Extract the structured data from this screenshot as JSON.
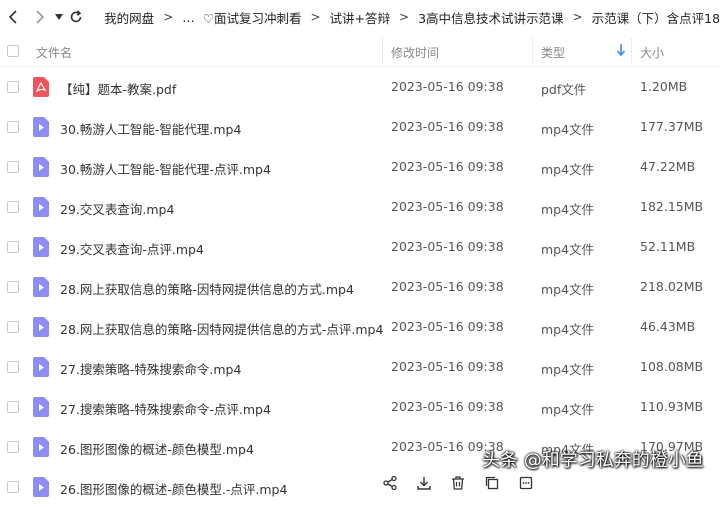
{
  "breadcrumb": [
    "我的网盘",
    "…",
    "♡面试复习冲刺看",
    "试讲+答辩",
    "3高中信息技术试讲示范课",
    "示范课（下）含点评18"
  ],
  "columns": {
    "name": "文件名",
    "time": "修改时间",
    "type": "类型",
    "size": "大小"
  },
  "sort_icon": "sort-down-arrow-icon",
  "colors": {
    "pdf": "#f0545c",
    "video": "#8c8cf2",
    "accent": "#3c8cf0"
  },
  "files": [
    {
      "name": "【纯】题本-教案.pdf",
      "time": "2023-05-16 09:38",
      "type": "pdf文件",
      "size": "1.20MB",
      "icon": "pdf-file-icon"
    },
    {
      "name": "30.畅游人工智能-智能代理.mp4",
      "time": "2023-05-16 09:38",
      "type": "mp4文件",
      "size": "177.37MB",
      "icon": "video-file-icon"
    },
    {
      "name": "30.畅游人工智能-智能代理-点评.mp4",
      "time": "2023-05-16 09:38",
      "type": "mp4文件",
      "size": "47.22MB",
      "icon": "video-file-icon"
    },
    {
      "name": "29.交叉表查询.mp4",
      "time": "2023-05-16 09:38",
      "type": "mp4文件",
      "size": "182.15MB",
      "icon": "video-file-icon"
    },
    {
      "name": "29.交叉表查询-点评.mp4",
      "time": "2023-05-16 09:38",
      "type": "mp4文件",
      "size": "52.11MB",
      "icon": "video-file-icon"
    },
    {
      "name": "28.网上获取信息的策略-因特网提供信息的方式.mp4",
      "time": "2023-05-16 09:38",
      "type": "mp4文件",
      "size": "218.02MB",
      "icon": "video-file-icon"
    },
    {
      "name": "28.网上获取信息的策略-因特网提供信息的方式-点评.mp4",
      "time": "2023-05-16 09:38",
      "type": "mp4文件",
      "size": "46.43MB",
      "icon": "video-file-icon"
    },
    {
      "name": "27.搜索策略-特殊搜索命令.mp4",
      "time": "2023-05-16 09:38",
      "type": "mp4文件",
      "size": "108.08MB",
      "icon": "video-file-icon"
    },
    {
      "name": "27.搜索策略-特殊搜索命令-点评.mp4",
      "time": "2023-05-16 09:38",
      "type": "mp4文件",
      "size": "110.93MB",
      "icon": "video-file-icon"
    },
    {
      "name": "26.图形图像的概述-颜色模型.mp4",
      "time": "2023-05-16 09:38",
      "type": "mp4文件",
      "size": "170.97MB",
      "icon": "video-file-icon"
    },
    {
      "name": "26.图形图像的概述-颜色模型.-点评.mp4",
      "time": "",
      "type": "",
      "size": "",
      "icon": "video-file-icon"
    }
  ],
  "toolbar_icons": [
    "share-icon",
    "download-icon",
    "delete-icon",
    "copy-icon",
    "more-icon"
  ],
  "watermark": "头条 @和学习私奔的橙小鱼"
}
